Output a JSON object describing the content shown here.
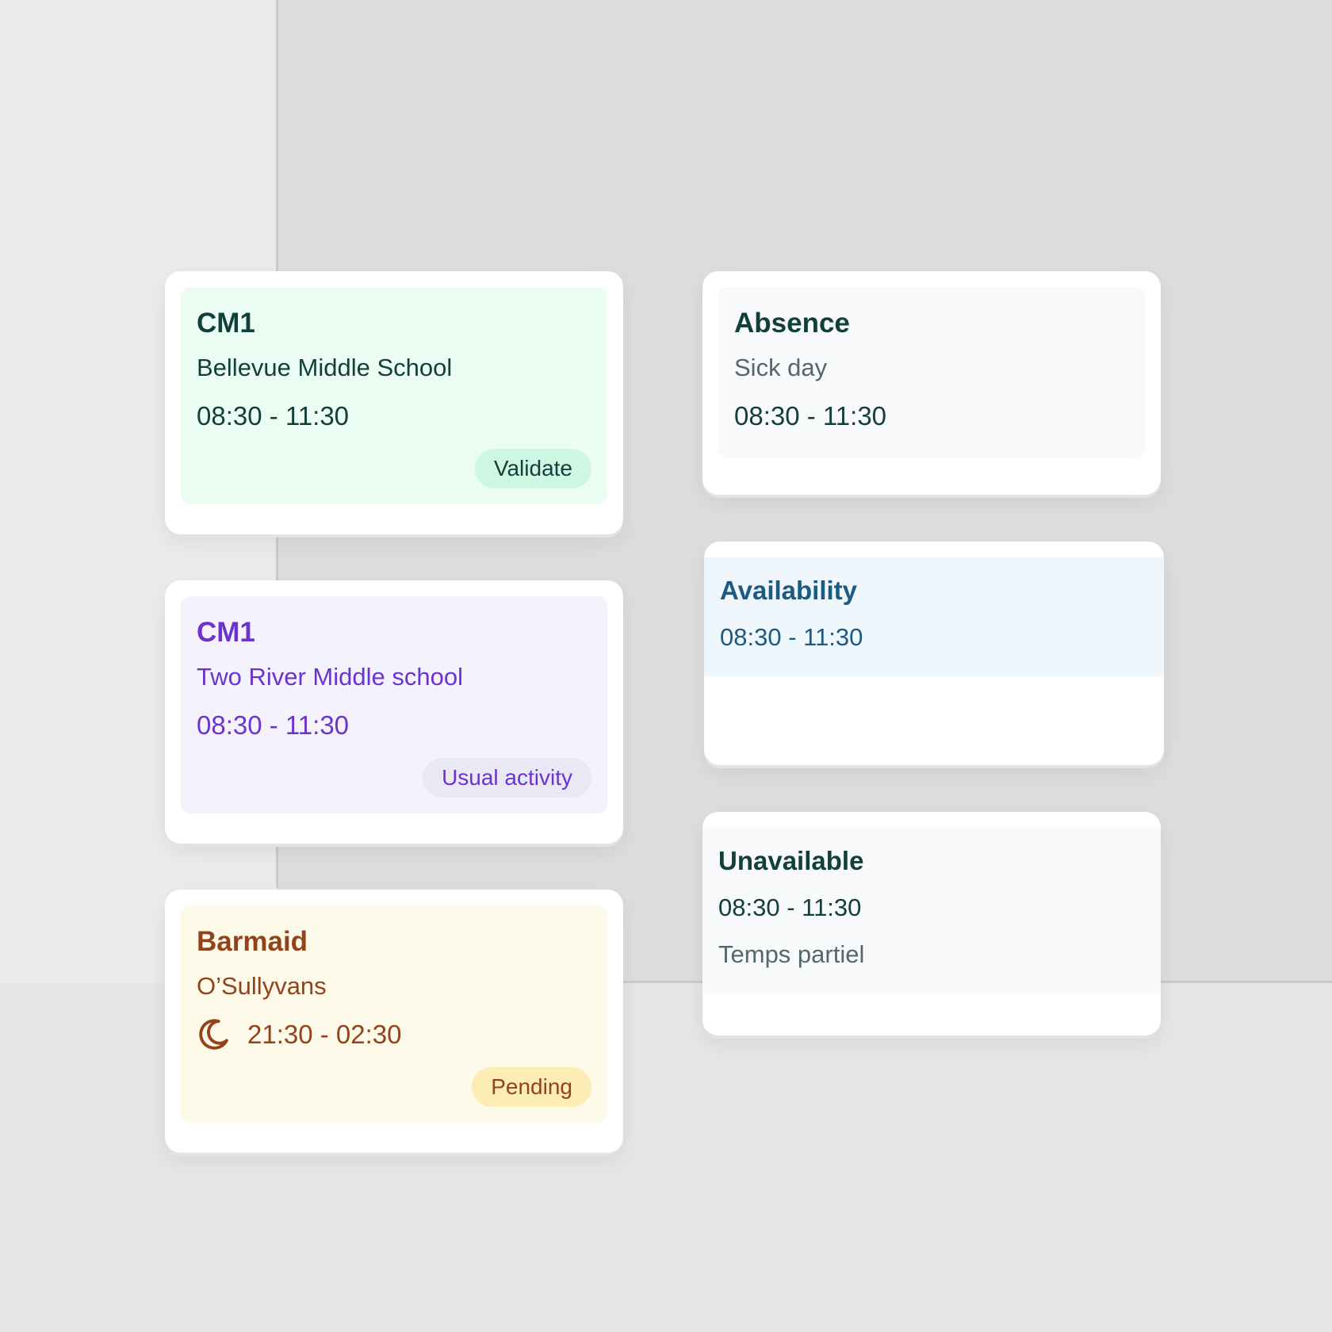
{
  "colors": {
    "validated_bg": "#ebfcf3",
    "usual_bg": "#f4f2fd",
    "pending_bg": "#fefaea",
    "availability_bg": "#eff7fd",
    "neutral_bg": "#f8f9fa"
  },
  "shifts": [
    {
      "title": "CM1",
      "location": "Bellevue Middle School",
      "time": "08:30 - 11:30",
      "status": "Validate"
    },
    {
      "title": "CM1",
      "location": "Two River Middle school",
      "time": "08:30 - 11:30",
      "status": "Usual activity"
    },
    {
      "title": "Barmaid",
      "location": "O’Sullyvans",
      "time": "21:30 - 02:30",
      "status": "Pending",
      "icon": "moon-icon"
    }
  ],
  "absence": {
    "title": "Absence",
    "reason": "Sick day",
    "time": "08:30 - 11:30"
  },
  "availability": {
    "title": "Availability",
    "time": "08:30 - 11:30"
  },
  "unavailable": {
    "title": "Unavailable",
    "time": "08:30 - 11:30",
    "note": "Temps partiel"
  }
}
